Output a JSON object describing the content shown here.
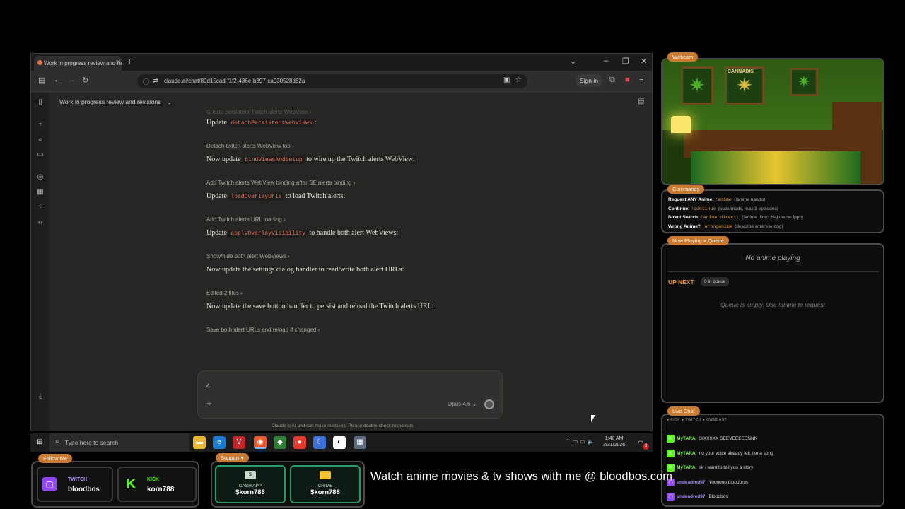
{
  "browser": {
    "tab_title": "Work in progress review and re",
    "hidden_label": "",
    "url": "claude.ai/chat/80d15cad-f1f2-436e-b897-ca930528d62a",
    "sign_in": "Sign in",
    "chat_title": "Work in progress review and revisions",
    "chat": [
      {
        "kind": "step",
        "text": "Create persistent Twitch alerts WebView"
      },
      {
        "kind": "msg",
        "before": "Update ",
        "code": "detachPersistentWebViews",
        "after": ":"
      },
      {
        "kind": "step",
        "text": "Detach twitch alerts WebView too"
      },
      {
        "kind": "msg",
        "before": "Now update ",
        "code": "bindViewsAndSetup",
        "after": " to wire up the Twitch alerts WebView:"
      },
      {
        "kind": "step",
        "text": "Add Twitch alerts WebView binding after SE alerts binding"
      },
      {
        "kind": "msg",
        "before": "Update ",
        "code": "loadOverlayUrls",
        "after": " to load Twitch alerts:"
      },
      {
        "kind": "step",
        "text": "Add Twitch alerts URL loading"
      },
      {
        "kind": "msg",
        "before": "Update ",
        "code": "applyOverlayVisibility",
        "after": " to handle both alert WebViews:"
      },
      {
        "kind": "step",
        "text": "Show/hide both alert WebViews"
      },
      {
        "kind": "msg",
        "before": "Now update the settings dialog handler to read/write both alert URLs:",
        "code": "",
        "after": ""
      },
      {
        "kind": "step",
        "text": "Edited 2 files"
      },
      {
        "kind": "msg",
        "before": "Now update the save button handler to persist and reload the Twitch alerts URL:",
        "code": "",
        "after": ""
      },
      {
        "kind": "step",
        "text": "Save both alert URLs and reload if changed"
      }
    ],
    "composer_text": "4",
    "model": "Opus 4.6",
    "disclaimer": "Claude is AI and can make mistakes. Please double-check responses."
  },
  "taskbar": {
    "search_placeholder": "Type here to search",
    "time": "1:40 AM",
    "date": "3/31/2026",
    "notif_count": "3"
  },
  "overlay": {
    "webcam_label": "Webcam",
    "poster_text": "CANNABIS",
    "commands_label": "Commands",
    "commands": [
      {
        "name": "Request ANY Anime:",
        "cmd": "!anime",
        "desc": "(!anime naruto)"
      },
      {
        "name": "Continue:",
        "cmd": "!continue",
        "desc": "(subs/mods, max 3 episodes)"
      },
      {
        "name": "Direct Search:",
        "cmd": "!anime direct:",
        "desc": "(!anime direct:Hajime no Ippo)"
      },
      {
        "name": "Wrong Anime?",
        "cmd": "!wronganime",
        "desc": "(describe what's wrong)"
      }
    ],
    "now_playing_label": "Now Playing + Queue",
    "no_anime": "No anime playing",
    "up_next": "UP NEXT",
    "queue_count": "0 in queue",
    "queue_empty": "Queue is empty! Use !anime to request",
    "live_chat_label": "Live Chat",
    "platforms": "● KICK  ● TWITCH  ● OWNCAST",
    "chat": [
      {
        "platform": "kick",
        "user": "MyTARA",
        "text": "SIXXXXX SEEVEEEEENNN",
        "color": "#53fc18"
      },
      {
        "platform": "kick",
        "user": "MyTARA",
        "text": "no your voice already felt like a song",
        "color": "#53fc18"
      },
      {
        "platform": "kick",
        "user": "MyTARA",
        "text": "sir i want to tell you a story",
        "color": "#53fc18"
      },
      {
        "platform": "twitch",
        "user": "undeadred97",
        "text": "Yoooooo bloodbros",
        "color": "#9146ff"
      },
      {
        "platform": "twitch",
        "user": "undeadred97",
        "text": "Bloodbos",
        "color": "#9146ff"
      }
    ],
    "follow_label": "Follow Me",
    "twitch_label": "TWITCH",
    "twitch_name": "bloodbos",
    "kick_label": "KICK",
    "kick_name": "korn788",
    "support_label": "Support ♥",
    "cashapp_label": "CASH APP",
    "cashapp_name": "$korn788",
    "chime_label": "CHIME",
    "chime_name": "$korn788",
    "banner": "Watch anime movies & tv shows with me @ bloodbos.com"
  },
  "colors": {
    "accent": "#c87a32",
    "kick": "#53fc18",
    "twitch": "#9146ff",
    "money": "#22a06b"
  }
}
